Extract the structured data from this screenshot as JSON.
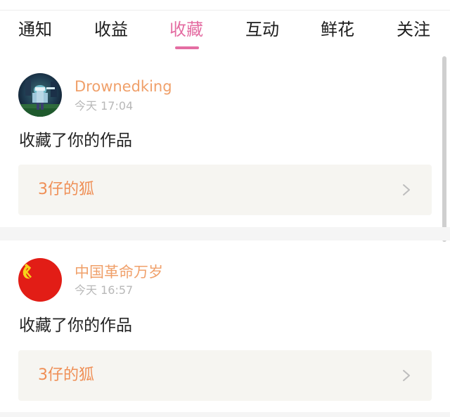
{
  "tabs": [
    {
      "label": "通知"
    },
    {
      "label": "收益"
    },
    {
      "label": "收藏"
    },
    {
      "label": "互动"
    },
    {
      "label": "鲜花"
    },
    {
      "label": "关注"
    }
  ],
  "active_tab": "收藏",
  "colors": {
    "accent": "#e46da2",
    "username": "#f0a06a",
    "work_title": "#ef8f56",
    "box_bg": "#f6f5f1"
  },
  "items": [
    {
      "username": "Drownedking",
      "time": "今天 17:04",
      "action": "收藏了你的作品",
      "work_title": "3仔的狐"
    },
    {
      "username": "中国革命万岁",
      "time": "今天 16:57",
      "action": "收藏了你的作品",
      "work_title": "3仔的狐"
    }
  ]
}
